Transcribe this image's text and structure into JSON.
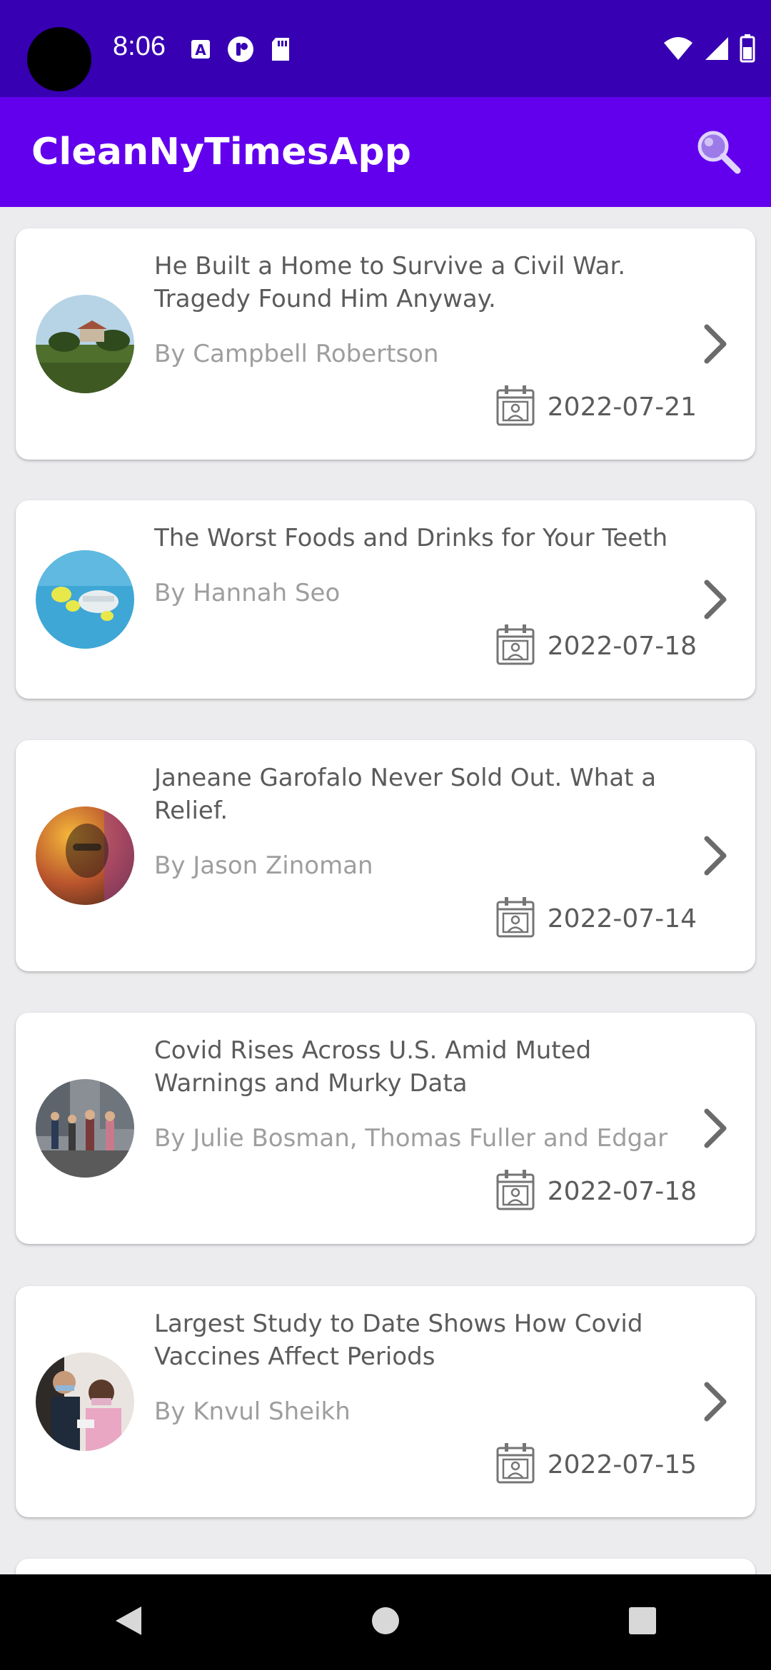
{
  "status_bar": {
    "time": "8:06",
    "left_icons": [
      "a-badge-icon",
      "paint-icon",
      "sd-card-icon"
    ],
    "right_icons": [
      "wifi-icon",
      "signal-icon",
      "battery-icon"
    ]
  },
  "app_bar": {
    "title": "CleanNyTimesApp",
    "search_icon": "search-icon"
  },
  "articles": [
    {
      "headline": "He Built a Home to Survive a Civil War. Tragedy Found Him Anyway.",
      "byline": "By Campbell Robertson",
      "date": "2022-07-21"
    },
    {
      "headline": "The Worst Foods and Drinks for Your Teeth",
      "byline": "By Hannah Seo",
      "date": "2022-07-18"
    },
    {
      "headline": "Janeane Garofalo Never Sold Out. What a Relief.",
      "byline": "By Jason Zinoman",
      "date": "2022-07-14"
    },
    {
      "headline": "Covid Rises Across U.S. Amid Muted Warnings and Murky Data",
      "byline": "By Julie Bosman, Thomas Fuller and Edgar",
      "date": "2022-07-18"
    },
    {
      "headline": "Largest Study to Date Shows How Covid Vaccines Affect Periods",
      "byline": "By Knvul Sheikh",
      "date": "2022-07-15"
    }
  ],
  "nav_bar": {
    "icons": [
      "back-icon",
      "home-icon",
      "recents-icon"
    ]
  },
  "colors": {
    "status_bar": "#3700b3",
    "app_bar": "#6200ee",
    "background": "#ececee"
  }
}
